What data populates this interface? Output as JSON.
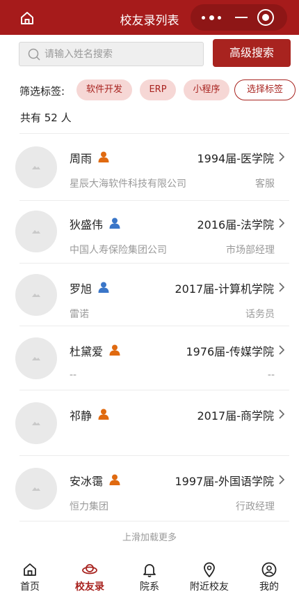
{
  "header": {
    "title": "校友录列表",
    "colors": {
      "primary": "#a61b1b"
    }
  },
  "search": {
    "placeholder": "请输入姓名搜索",
    "value": "",
    "advanced_label": "高级搜索"
  },
  "filter": {
    "label": "筛选标签:",
    "tags": [
      "软件开发",
      "ERP",
      "小程序"
    ],
    "choose_label": "选择标签"
  },
  "count_text": "共有 52 人",
  "alumni": [
    {
      "name": "周雨",
      "gender_icon": "person-orange-icon",
      "grade": "1994届-医学院",
      "company": "星辰大海软件科技有限公司",
      "job": "客服"
    },
    {
      "name": "狄盛伟",
      "gender_icon": "person-blue-icon",
      "grade": "2016届-法学院",
      "company": "中国人寿保险集团公司",
      "job": "市场部经理"
    },
    {
      "name": "罗旭",
      "gender_icon": "person-blue-icon",
      "grade": "2017届-计算机学院",
      "company": "雷诺",
      "job": "话务员"
    },
    {
      "name": "杜黛爱",
      "gender_icon": "person-orange-icon",
      "grade": "1976届-传媒学院",
      "company": "--",
      "job": "--"
    },
    {
      "name": "祁静",
      "gender_icon": "person-orange-icon",
      "grade": "2017届-商学院",
      "company": "",
      "job": ""
    },
    {
      "name": "安冰霭",
      "gender_icon": "person-orange-icon",
      "grade": "1997届-外国语学院",
      "company": "恒力集团",
      "job": "行政经理"
    }
  ],
  "load_more": "上滑加载更多",
  "tabbar": {
    "items": [
      {
        "label": "首页",
        "icon": "home-icon"
      },
      {
        "label": "校友录",
        "icon": "alumni-icon",
        "active": true
      },
      {
        "label": "院系",
        "icon": "bell-icon"
      },
      {
        "label": "附近校友",
        "icon": "location-icon"
      },
      {
        "label": "我的",
        "icon": "user-icon"
      }
    ]
  }
}
